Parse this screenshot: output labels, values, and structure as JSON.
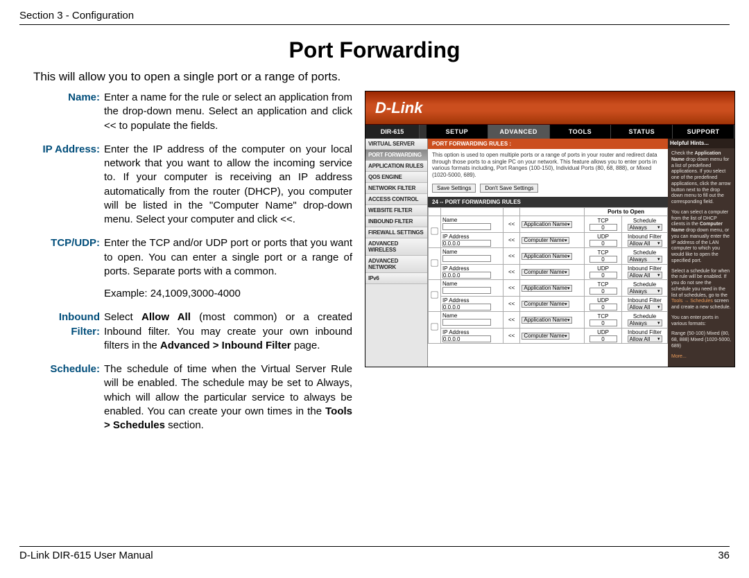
{
  "header": {
    "section": "Section 3 - Configuration"
  },
  "title": "Port Forwarding",
  "intro": "This will allow you to open a single port or a range of ports.",
  "defs": {
    "name": {
      "label": "Name:",
      "text": "Enter a name for the rule or select an application from the drop-down menu. Select an application and click << to populate the fields."
    },
    "ip": {
      "label": "IP Address:",
      "text": "Enter the IP address of the computer on your local network that you want to allow the incoming service to. If your computer is receiving an IP address automatically from the router (DHCP), you computer will be listed in the \"Computer Name\" drop-down menu. Select your computer and click <<."
    },
    "tcpudp": {
      "label": "TCP/UDP:",
      "text": "Enter the TCP and/or UDP port or ports that you want to open. You can enter a single port or a range of ports. Separate ports with a common.",
      "example": "Example: 24,1009,3000-4000"
    },
    "inbound": {
      "label": "Inbound Filter:",
      "text_pre": "Select ",
      "text_bold1": "Allow All",
      "text_mid": " (most common) or a created Inbound filter. You may create your own inbound filters in the ",
      "text_bold2": "Advanced > Inbound Filter",
      "text_post": " page."
    },
    "schedule": {
      "label": "Schedule:",
      "text_pre": "The schedule of time when the Virtual Server Rule will be enabled. The schedule may be set to Always, which will allow the particular service to always be enabled. You can create your own times in the ",
      "text_bold": "Tools > Schedules",
      "text_post": " section."
    }
  },
  "shot": {
    "logo": "D-Link",
    "model": "DIR-615",
    "tabs": [
      "SETUP",
      "ADVANCED",
      "TOOLS",
      "STATUS",
      "SUPPORT"
    ],
    "active_tab": 1,
    "sidebar": [
      "VIRTUAL SERVER",
      "PORT FORWARDING",
      "APPLICATION RULES",
      "QOS ENGINE",
      "NETWORK FILTER",
      "ACCESS CONTROL",
      "WEBSITE FILTER",
      "INBOUND FILTER",
      "FIREWALL SETTINGS",
      "ADVANCED WIRELESS",
      "ADVANCED NETWORK",
      "IPv6"
    ],
    "sidebar_active": 1,
    "rules_title": "PORT FORWARDING RULES :",
    "rules_desc": "This option is used to open multiple ports or a range of ports in your router and redirect data through those ports to a single PC on your network. This feature allows you to enter ports in various formats including, Port Ranges (100-150), Individual Ports (80, 68, 888), or Mixed (1020-5000, 689).",
    "save": "Save Settings",
    "dont_save": "Don't Save Settings",
    "count_bar": "24 -- PORT FORWARDING RULES",
    "col_ports": "Ports to Open",
    "row_labels": {
      "name": "Name",
      "ip": "IP Address",
      "ip_val": "0.0.0.0",
      "btn": "<<",
      "app": "Application Name",
      "comp": "Computer Name",
      "tcp": "TCP",
      "udp": "UDP",
      "zero": "0",
      "sched": "Schedule",
      "always": "Always",
      "inb": "Inbound Filter",
      "allow": "Allow All"
    },
    "hints": {
      "title": "Helpful Hints...",
      "p1a": "Check the ",
      "p1b": "Application Name",
      "p1c": " drop down menu for a list of predefined applications. If you select one of the predefined applications, click the arrow button next to the drop down menu to fill out the corresponding field.",
      "p2a": "You can select a computer from the list of DHCP clients in the ",
      "p2b": "Computer Name",
      "p2c": " drop down menu, or you can manually enter the IP address of the LAN computer to which you would like to open the specified port.",
      "p3a": "Select a schedule for when the rule will be enabled. If you do not see the schedule you need in the list of schedules, go to the ",
      "p3b": "Tools → Schedules",
      "p3c": " screen and create a new schedule.",
      "p4a": "You can enter ports in various formats:",
      "p4b": "Range (50-100) Mixed (80, 68, 888) Mixed (1020-5000, 689)",
      "more": "More..."
    }
  },
  "footer": {
    "left": "D-Link DIR-615 User Manual",
    "right": "36"
  }
}
